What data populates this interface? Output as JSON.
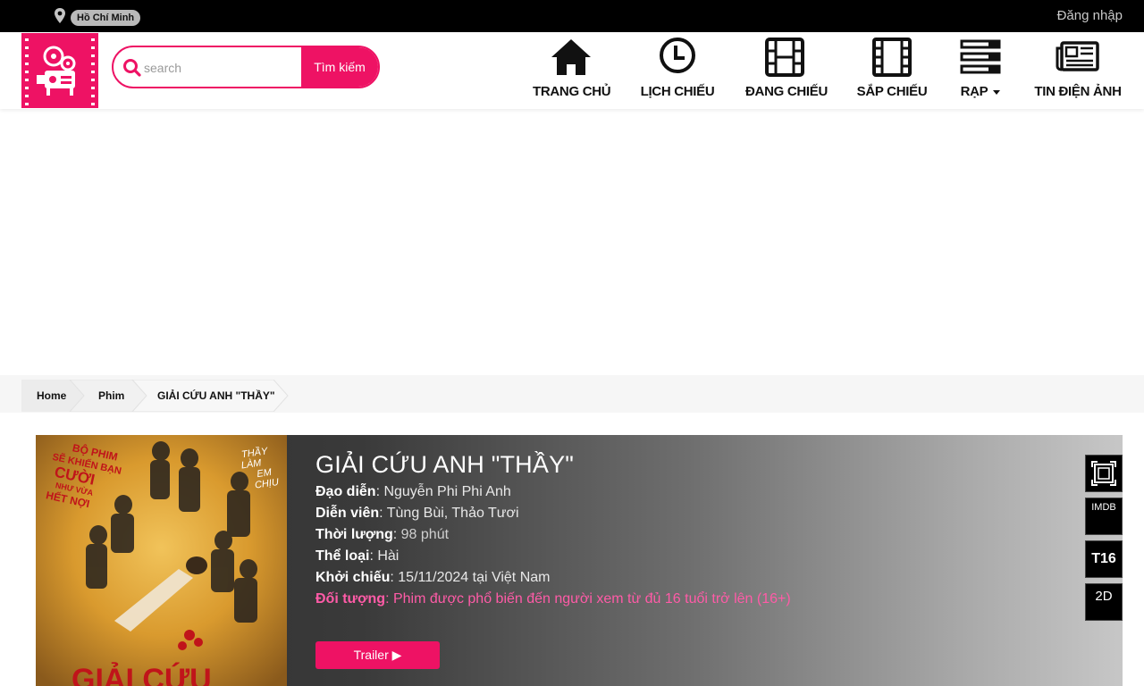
{
  "topbar": {
    "location": "Hồ Chí Minh",
    "login": "Đăng nhập"
  },
  "search": {
    "placeholder": "search",
    "button": "Tìm kiếm"
  },
  "nav": {
    "home": "TRANG CHỦ",
    "schedule": "LỊCH CHIẾU",
    "now_showing": "ĐANG CHIẾU",
    "coming_soon": "SẮP CHIẾU",
    "cinemas": "RẠP",
    "news": "TIN ĐIỆN ẢNH"
  },
  "breadcrumb": [
    "Home",
    "Phim",
    "GIẢI CỨU ANH \"THẦY\""
  ],
  "movie": {
    "title": "GIẢI CỨU ANH \"THẦY\"",
    "director_label": "Đạo diễn",
    "director": "Nguyễn Phi Phi Anh",
    "cast_label": "Diễn viên",
    "cast": "Tùng Bùi, Thảo Tươi",
    "duration_label": "Thời lượng",
    "duration": "98 phút",
    "genre_label": "Thể loại",
    "genre": "Hài",
    "release_label": "Khởi chiếu",
    "release": "15/11/2024 tại Việt Nam",
    "audience_label": "Đối tượng",
    "audience": "Phim được phổ biến đến người xem từ đủ 16 tuổi trở lên (16+)",
    "trailer_button": "Trailer ▶"
  },
  "poster": {
    "tagline_left": [
      "BỘ PHIM",
      "SẼ KHIẾN BẠN",
      "CƯỜI",
      "NHƯ VỪA",
      "HẾT NỢI"
    ],
    "tagline_right": [
      "THẦY",
      "LÀM",
      "EM",
      "CHỊU"
    ],
    "title_art": "GIẢI CỨU"
  },
  "badges": {
    "imdb": "IMDB",
    "rating": "T16",
    "format": "2D"
  },
  "colors": {
    "accent": "#ee1264",
    "audience_text": "#ff5ba7"
  }
}
